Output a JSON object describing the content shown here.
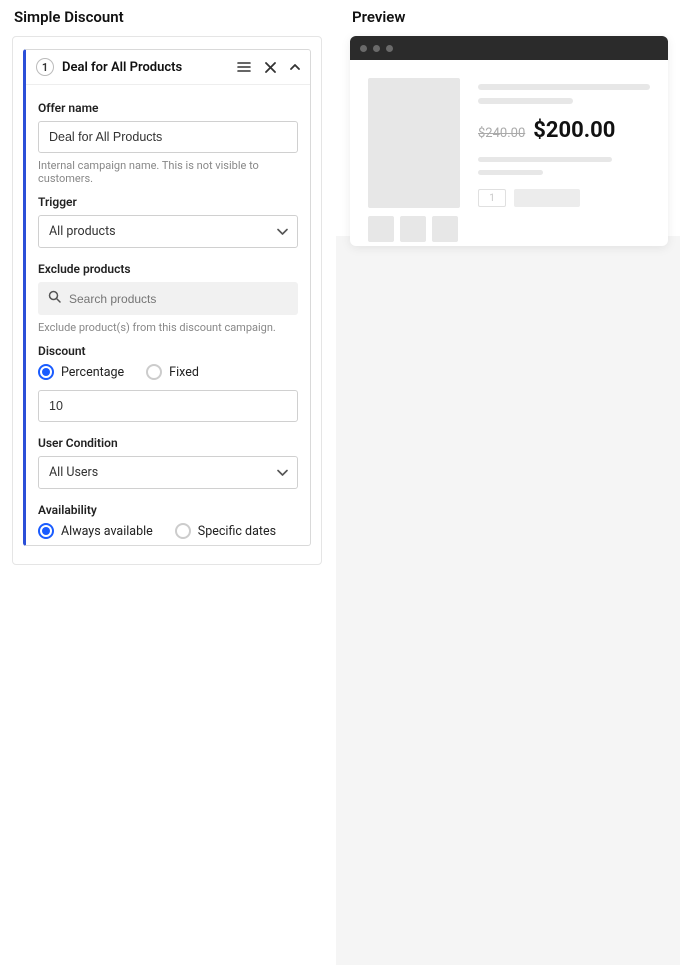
{
  "left": {
    "panel_title": "Simple Discount",
    "offer": {
      "index": "1",
      "title": "Deal for All Products",
      "name_label": "Offer name",
      "name_value": "Deal for All Products",
      "name_help": "Internal campaign name. This is not visible to customers.",
      "trigger_label": "Trigger",
      "trigger_value": "All products",
      "exclude_label": "Exclude products",
      "exclude_placeholder": "Search products",
      "exclude_help": "Exclude product(s) from this discount campaign.",
      "discount_label": "Discount",
      "discount_type_percentage": "Percentage",
      "discount_type_fixed": "Fixed",
      "discount_value": "10",
      "user_cond_label": "User Condition",
      "user_cond_value": "All Users",
      "availability_label": "Availability",
      "availability_always": "Always available",
      "availability_specific": "Specific dates"
    }
  },
  "right": {
    "panel_title": "Preview",
    "price_old": "$240.00",
    "price_new": "$200.00",
    "qty_placeholder": "1"
  }
}
